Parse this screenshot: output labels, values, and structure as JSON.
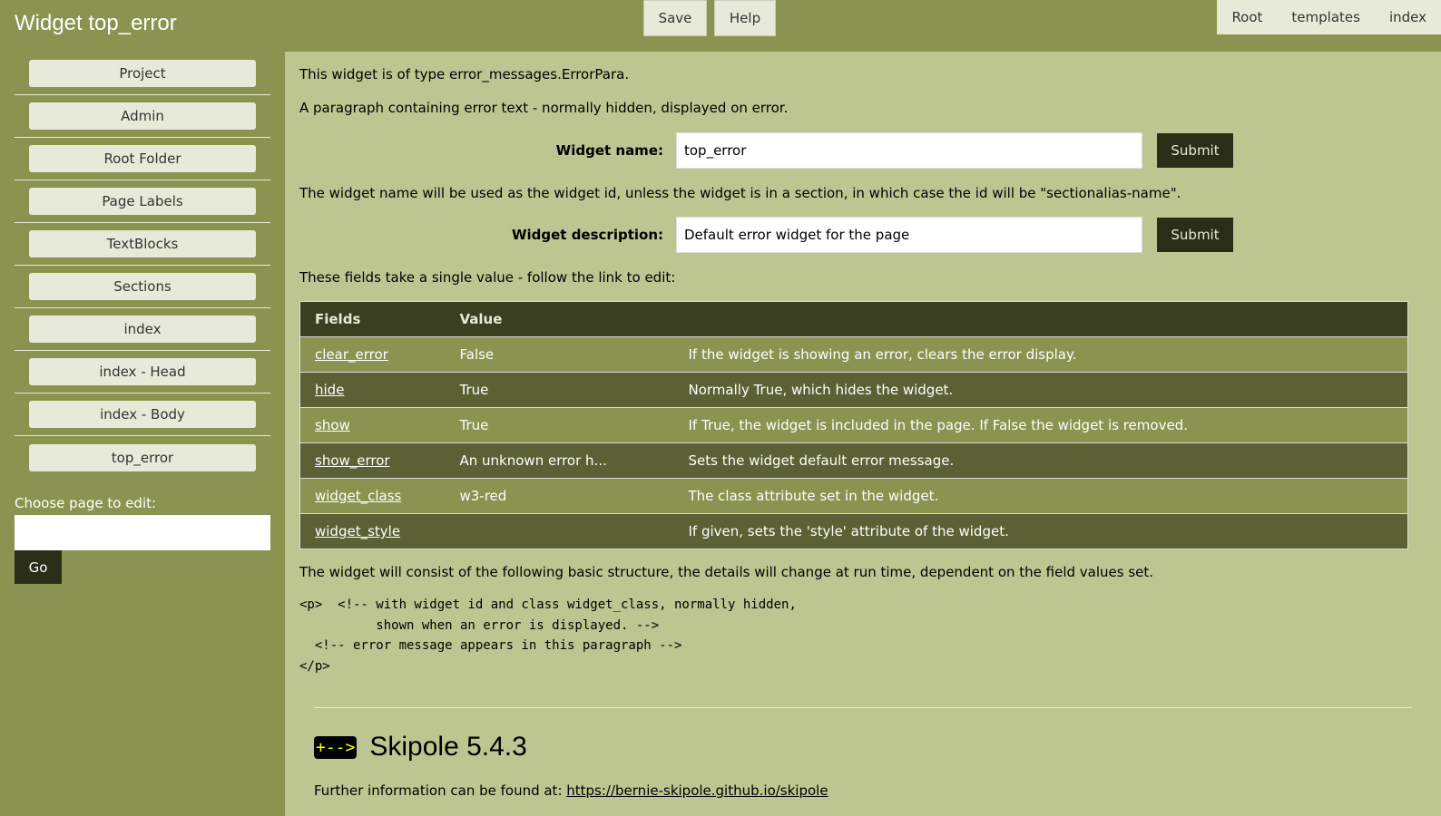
{
  "header": {
    "title": "Widget top_error",
    "save": "Save",
    "help": "Help",
    "nav": [
      "Root",
      "templates",
      "index"
    ]
  },
  "sidebar": {
    "items": [
      "Project",
      "Admin",
      "Root Folder",
      "Page Labels",
      "TextBlocks",
      "Sections",
      "index",
      "index - Head",
      "index - Body",
      "top_error"
    ],
    "choose_label": "Choose page to edit:",
    "input_value": "",
    "go": "Go"
  },
  "main": {
    "type_text": "This widget is of type error_messages.ErrorPara.",
    "desc_text": "A paragraph containing error text - normally hidden, displayed on error.",
    "name_label": "Widget name:",
    "name_value": "top_error",
    "submit": "Submit",
    "name_note": "The widget name will be used as the widget id, unless the widget is in a section, in which case the id will be \"sectionalias-name\".",
    "desc_label": "Widget description:",
    "desc_value": "Default error widget for the page",
    "fields_intro": "These fields take a single value - follow the link to edit:",
    "table": {
      "headers": [
        "Fields",
        "Value",
        ""
      ],
      "rows": [
        [
          "clear_error",
          "False",
          "If the widget is showing an error, clears the error display."
        ],
        [
          "hide",
          "True",
          "Normally True, which hides the widget."
        ],
        [
          "show",
          "True",
          "If True, the widget is included in the page. If False the widget is removed."
        ],
        [
          "show_error",
          "An unknown error h...",
          "Sets the widget default error message."
        ],
        [
          "widget_class",
          "w3-red",
          "The class attribute set in the widget."
        ],
        [
          "widget_style",
          "",
          "If given, sets the 'style' attribute of the widget."
        ]
      ]
    },
    "structure_intro": "The widget will consist of the following basic structure, the details will change at run time, dependent on the field values set.",
    "code": "<p>  <!-- with widget id and class widget_class, normally hidden,\n          shown when an error is displayed. -->\n  <!-- error message appears in this paragraph -->\n</p>",
    "footer": {
      "logo": "+-->",
      "version": "Skipole 5.4.3",
      "info": "Further information can be found at: ",
      "link": "https://bernie-skipole.github.io/skipole"
    }
  }
}
